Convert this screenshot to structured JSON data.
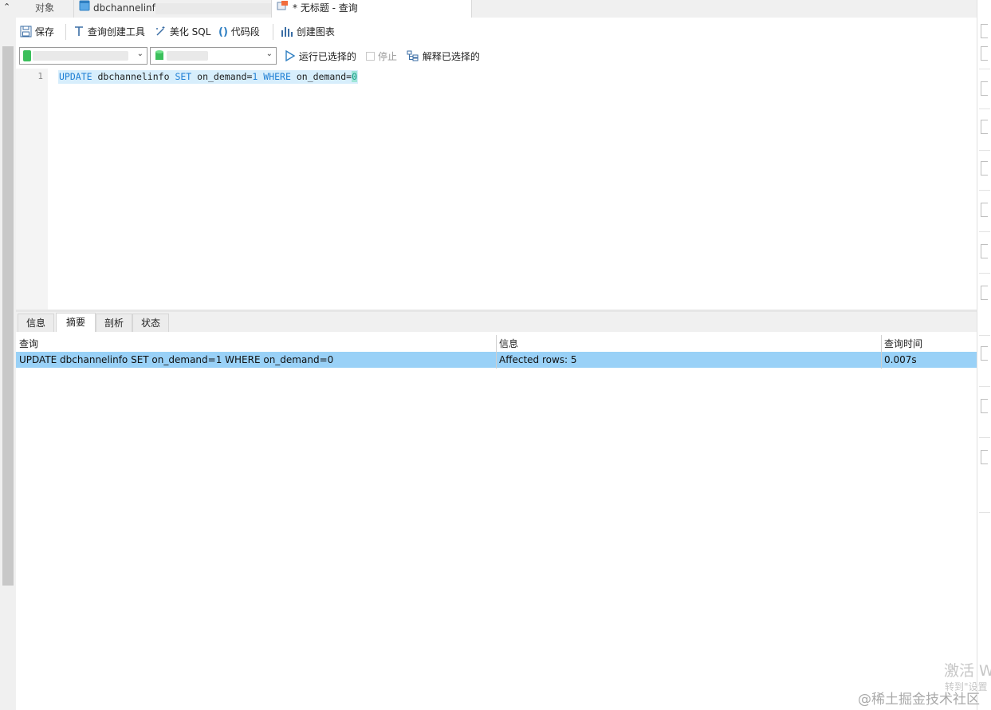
{
  "tabs": {
    "objects_label": "对象",
    "table_label": "dbchannelinf",
    "query_label": "* 无标题 - 查询"
  },
  "toolbar": {
    "save_label": "保存",
    "query_builder_label": "查询创建工具",
    "beautify_label": "美化 SQL",
    "snippet_label": "代码段",
    "create_chart_label": "创建图表"
  },
  "connection": {
    "run_selected_label": "运行已选择的",
    "stop_label": "停止",
    "explain_selected_label": "解释已选择的"
  },
  "editor": {
    "line_number": "1",
    "code": {
      "update": "UPDATE",
      "table": "dbchannelinfo",
      "set": "SET",
      "assign": "on_demand=",
      "assign_value": "1",
      "where": "WHERE",
      "cond": "on_demand=",
      "cond_value": "0"
    }
  },
  "result_tabs": [
    "信息",
    "摘要",
    "剖析",
    "状态"
  ],
  "active_result_tab": "摘要",
  "results": {
    "columns": [
      "查询",
      "信息",
      "查询时间"
    ],
    "rows": [
      [
        "UPDATE dbchannelinfo SET on_demand=1 WHERE on_demand=0",
        "Affected rows: 5",
        "0.007s"
      ]
    ],
    "selected_row_color": "#99d1f7"
  },
  "watermarks": {
    "activate": "激活 W",
    "activate_sub": "转到\"设置",
    "site": "@稀土掘金技术社区"
  },
  "colors": {
    "keyword": "#1f7fd4",
    "number": "#1b9a8a",
    "selection": "#d7eefc"
  }
}
